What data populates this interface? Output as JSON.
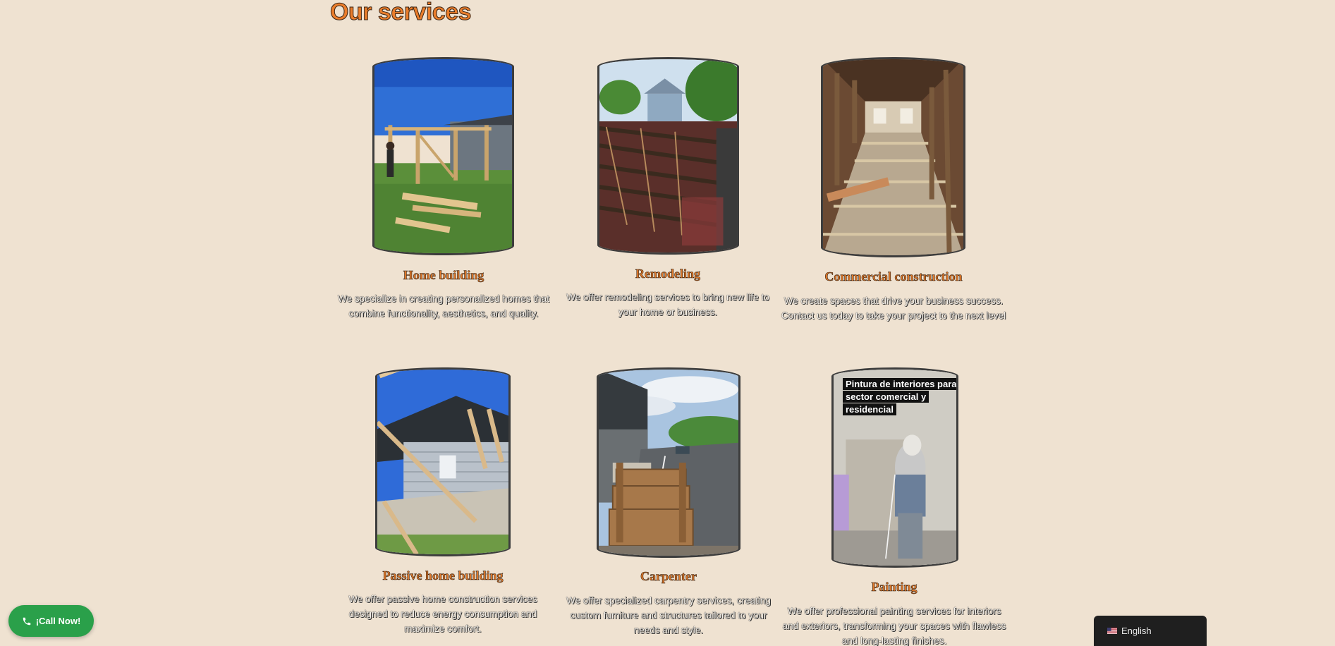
{
  "section": {
    "title": "Our services"
  },
  "services": [
    {
      "title": "Home building",
      "description": "We specialize in creating personalized homes that combine functionality, aesthetics, and quality."
    },
    {
      "title": "Remodeling",
      "description": "We offer remodeling services to bring new life to your home or business."
    },
    {
      "title": "Commercial construction",
      "description": "We create spaces that drive your business success. Contact us today to take your project to the next level"
    },
    {
      "title": "Passive home building",
      "description": "We offer passive home construction services designed to reduce energy consumption and maximize comfort."
    },
    {
      "title": "Carpenter",
      "description": "We offer specialized carpentry services, creating custom furniture and structures tailored to your needs and style."
    },
    {
      "title": "Painting",
      "description": "We offer professional painting services for interiors and exteriors, transforming your spaces with flawless and long-lasting finishes.",
      "photo_caption": "Pintura de interiores para sector comercial y residencial"
    }
  ],
  "call_button": {
    "label": "¡Call Now!",
    "icon": "phone-icon",
    "color": "#2aa04a"
  },
  "language_switcher": {
    "label": "English",
    "flag": "us-flag-icon"
  },
  "colors": {
    "background": "#efe2d1",
    "accent": "#ea7d2b"
  }
}
